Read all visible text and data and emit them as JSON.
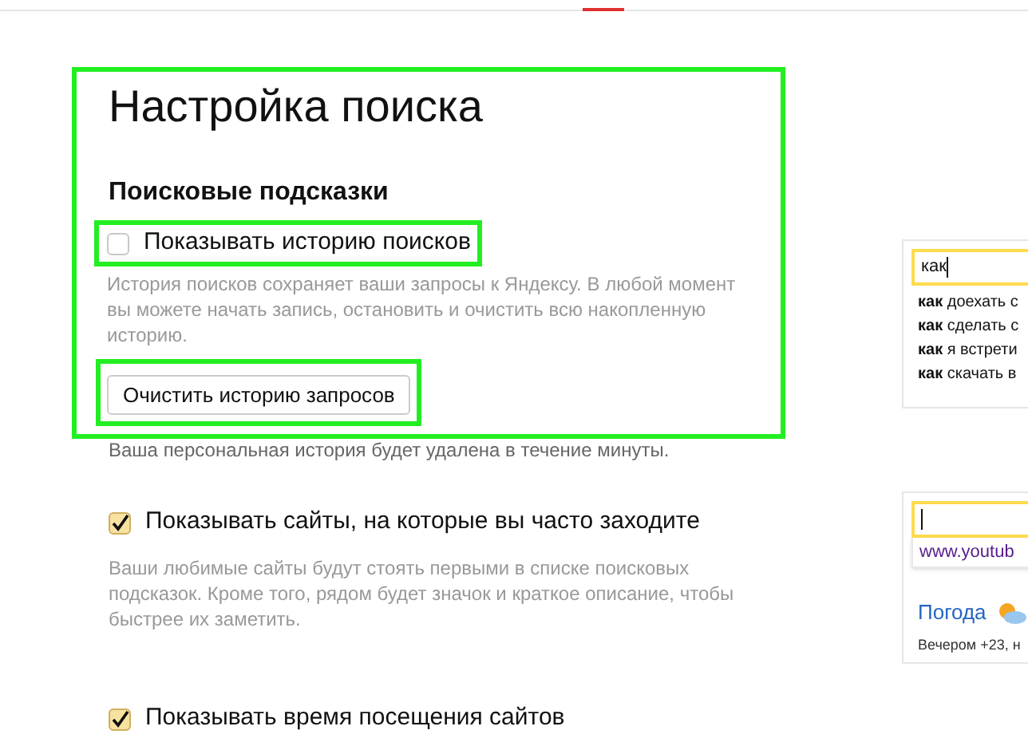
{
  "title": "Настройка поиска",
  "highlighted": true,
  "section": {
    "heading": "Поисковые подсказки"
  },
  "options": [
    {
      "label": "Показывать историю поисков",
      "checked": false,
      "highlighted": true,
      "description": "История поисков сохраняет ваши запросы к Яндексу. В любой момент вы можете начать запись, остановить и очистить всю накопленную историю.",
      "button": {
        "label": "Очистить историю запросов",
        "highlighted": true
      },
      "note": "Ваша персональная история будет удалена в течение минуты."
    },
    {
      "label": "Показывать сайты, на которые вы часто заходите",
      "checked": true,
      "highlighted": false,
      "description": "Ваши любимые сайты будут стоять первыми в списке поисковых подсказок. Кроме того, рядом будет значок и краткое описание, чтобы быстрее их заметить."
    },
    {
      "label": "Показывать время посещения сайтов",
      "checked": true,
      "highlighted": false
    }
  ],
  "previews": [
    {
      "query": "как",
      "suggestions": [
        "**как** доехать с",
        "**как** сделать с",
        "**как** я встрети",
        "**как** скачать в"
      ]
    },
    {
      "suggestions": [
        "www.youtub"
      ],
      "weather": {
        "title": "Погода",
        "forecast": "Вечером +23, н"
      }
    }
  ]
}
